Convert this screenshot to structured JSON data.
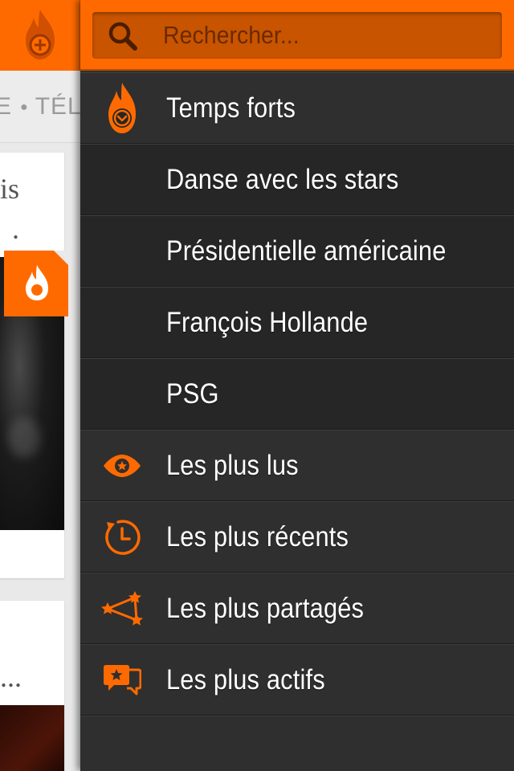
{
  "colors": {
    "accent": "#ff6a00",
    "drawer_bg": "#2f2f2f",
    "drawer_alt_bg": "#262626",
    "text": "#ffffff"
  },
  "background_page": {
    "nav_text": "E",
    "nav_text_2": "TÉL",
    "card1_lines": [
      "is",
      "."
    ],
    "card2_text": "..."
  },
  "search": {
    "placeholder": "Rechercher...",
    "icon": "search-icon"
  },
  "menu": {
    "items": [
      {
        "label": "Temps forts",
        "icon": "flame-chevron-icon"
      },
      {
        "label": "Danse avec les stars",
        "icon": ""
      },
      {
        "label": "Présidentielle américaine",
        "icon": ""
      },
      {
        "label": "François Hollande",
        "icon": ""
      },
      {
        "label": "PSG",
        "icon": ""
      },
      {
        "label": "Les plus lus",
        "icon": "eye-icon"
      },
      {
        "label": "Les plus récents",
        "icon": "clock-icon"
      },
      {
        "label": "Les plus partagés",
        "icon": "share-network-icon"
      },
      {
        "label": "Les plus actifs",
        "icon": "comments-icon"
      }
    ]
  }
}
